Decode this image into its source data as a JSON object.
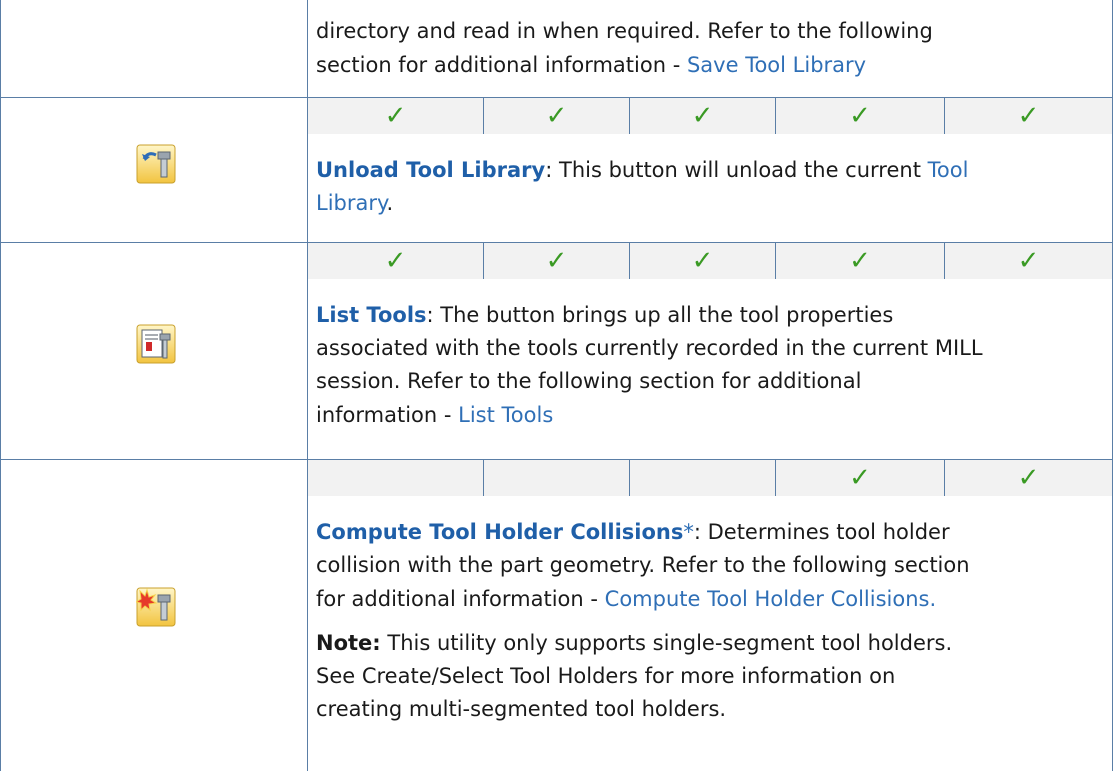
{
  "rows": [
    {
      "body": {
        "line1": "directory and read in when required.  Refer to the following",
        "line2_prefix": "section for additional information - ",
        "line2_link": "Save Tool Library"
      }
    },
    {
      "icon": "unload-tool-library-icon",
      "checks": [
        true,
        true,
        true,
        true,
        true
      ],
      "check_glyph": "✓",
      "title": "Unload Tool Library",
      "after_title": ": This button will unload the current ",
      "link_part1": "Tool",
      "link_part2": "Library",
      "end": "."
    },
    {
      "icon": "list-tools-icon",
      "checks": [
        true,
        true,
        true,
        true,
        true
      ],
      "check_glyph": "✓",
      "title": "List Tools",
      "line1_rest": ": The button brings up all the tool properties",
      "line2": "associated with the tools currently recorded in the current MILL",
      "line3": "session.  Refer to the following section for additional",
      "line4_prefix": "information - ",
      "line4_link": "List Tools"
    },
    {
      "icon": "compute-tool-holder-collisions-icon",
      "checks": [
        false,
        false,
        false,
        true,
        true
      ],
      "check_glyph": "✓",
      "title": "Compute Tool Holder Collisions",
      "asterisk": "*",
      "line1_rest": ": Determines tool holder",
      "line2": "collision with the part geometry.  Refer to the following section",
      "line3_prefix": "for additional information - ",
      "line3_link": "Compute Tool Holder Collisions.",
      "note_label": "Note:",
      "note_line1_rest": " This utility only supports single-segment tool holders.",
      "note_line2": "See Create/Select Tool Holders for more information on",
      "note_line3": "creating multi-segmented tool holders."
    }
  ],
  "colors": {
    "border": "#5a7ea6",
    "link": "#2f6fb6",
    "check": "#3a9a24",
    "check_bg": "#f2f2f2"
  }
}
